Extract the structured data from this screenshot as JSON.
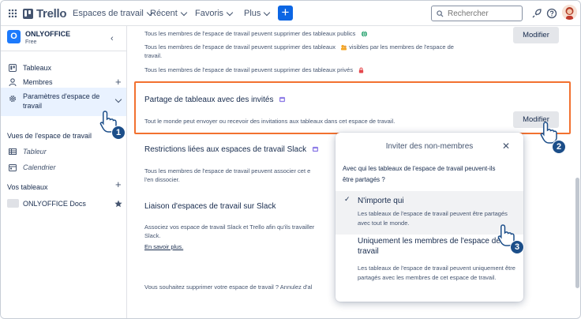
{
  "topbar": {
    "logo": "Trello",
    "nav": [
      "Espaces de travail",
      "Récent",
      "Favoris",
      "Plus"
    ],
    "search_placeholder": "Rechercher"
  },
  "sidebar": {
    "workspace_initial": "O",
    "workspace_name": "ONLYOFFICE",
    "workspace_plan": "Free",
    "items": [
      {
        "label": "Tableaux"
      },
      {
        "label": "Membres"
      },
      {
        "label": "Paramètres d'espace de travail"
      }
    ],
    "views_title": "Vues de l'espace de travail",
    "views": [
      "Tableur",
      "Calendrier"
    ],
    "boards_title": "Vos tableaux",
    "boards": [
      "ONLYOFFICE Docs"
    ]
  },
  "main": {
    "line_public": "Tous les membres de l'espace de travail peuvent supprimer des tableaux publics",
    "line_visible": "Tous les membres de l'espace de travail peuvent supprimer des tableaux",
    "line_visible_suffix": "visibles par les membres de l'espace de",
    "line_visible_2": "travail.",
    "line_private": "Tous les membres de l'espace de travail peuvent supprimer des tableaux privés",
    "modify_label": "Modifier",
    "sharing_title": "Partage de tableaux avec des invités",
    "sharing_desc": "Tout le monde peut envoyer ou recevoir des invitations aux tableaux dans cet espace de travail.",
    "slack_restrictions_title": "Restrictions liées aux espaces de travail Slack",
    "slack_restrictions_desc_1": "Tous les membres de l'espace de travail peuvent associer cet e",
    "slack_restrictions_desc_2": "l'en dissocier.",
    "slack_link_title": "Liaison d'espaces de travail sur Slack",
    "slack_link_desc_1": "Associez vos espace de travail Slack et Trello afin qu'ils travailler",
    "slack_link_desc_2": "Slack.",
    "learn_more": "En savoir plus.",
    "delete_question": "Vous souhaitez supprimer votre espace de travail ? Annulez d'al"
  },
  "popup": {
    "title": "Inviter des non-membres",
    "question": "Avec qui les tableaux de l'espace de travail peuvent-ils être partagés ?",
    "option1_title": "N'importe qui",
    "option1_desc": "Les tableaux de l'espace de travail peuvent être partagés avec tout le monde.",
    "option2_title": "Uniquement les membres de l'espace de travail",
    "option2_desc": "Les tableaux de l'espace de travail peuvent uniquement être partagés avec les membres de cet espace de travail."
  },
  "steps": [
    "1",
    "2",
    "3"
  ],
  "colors": {
    "accent": "#0c66e4",
    "highlight": "#f27130",
    "step": "#1c4e89"
  }
}
